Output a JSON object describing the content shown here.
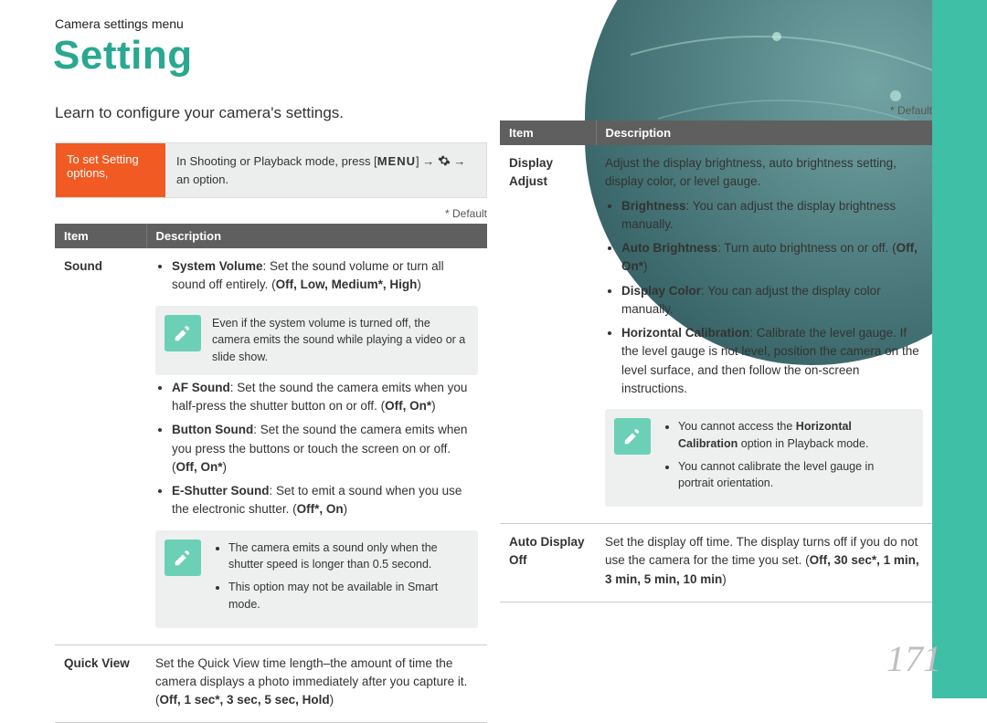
{
  "breadcrumb": "Camera settings menu",
  "title": "Setting",
  "intro": "Learn to configure your camera's settings.",
  "default_note": "* Default",
  "setbox": {
    "label": "To set Setting options,",
    "body_pre": "In Shooting or Playback mode, press [",
    "body_menu": "MENU",
    "body_mid": "] → ",
    "body_post": " → an option."
  },
  "left_table": {
    "headers": {
      "item": "Item",
      "desc": "Description"
    },
    "rows": [
      {
        "item": "Sound",
        "bullets": [
          {
            "label": "System Volume",
            "text": ": Set the sound volume or turn all sound off entirely. (",
            "opts": "Off, Low, Medium*, High",
            "tail": ")"
          }
        ],
        "note1": "Even if the system volume is turned off, the camera emits the sound while playing a video or a slide show.",
        "bullets2": [
          {
            "label": "AF Sound",
            "text": ": Set the sound the camera emits when you half-press the shutter button on or off. (",
            "opts": "Off, On*",
            "tail": ")"
          },
          {
            "label": "Button Sound",
            "text": ": Set the sound the camera emits when you press the buttons or touch the screen on or off. (",
            "opts": "Off, On*",
            "tail": ")"
          },
          {
            "label": "E-Shutter Sound",
            "text": ": Set to emit a sound when you use the electronic shutter. (",
            "opts": "Off*, On",
            "tail": ")"
          }
        ],
        "note2": [
          "The camera emits a sound only when the shutter speed is longer than 0.5 second.",
          "This option may not be available in Smart mode."
        ]
      },
      {
        "item": "Quick View",
        "plain_pre": "Set the Quick View time length–the amount of time the camera displays a photo immediately after you capture it. (",
        "opts": "Off, 1 sec*, 3 sec, 5 sec, Hold",
        "plain_post": ")"
      }
    ]
  },
  "right_table": {
    "headers": {
      "item": "Item",
      "desc": "Description"
    },
    "rows": [
      {
        "item": "Display Adjust",
        "lead": "Adjust the display brightness, auto brightness setting, display color, or level gauge.",
        "bullets": [
          {
            "label": "Brightness",
            "text": ": You can adjust the display brightness manually."
          },
          {
            "label": "Auto Brightness",
            "text": ": Turn auto brightness on or off. (",
            "opts": "Off, On*",
            "tail": ")"
          },
          {
            "label": "Display Color",
            "text": ": You can adjust the display color manually."
          },
          {
            "label": "Horizontal Calibration",
            "text": ": Calibrate the level gauge. If the level gauge is not level, position the camera on the level surface, and then follow the on-screen instructions."
          }
        ],
        "note": [
          {
            "pre": "You cannot access the ",
            "bold": "Horizontal Calibration",
            "post": " option in Playback mode."
          },
          {
            "pre": "You cannot calibrate the level gauge in portrait orientation.",
            "bold": "",
            "post": ""
          }
        ]
      },
      {
        "item": "Auto Display Off",
        "plain_pre": "Set the display off time. The display turns off if you do not use the camera for the time you set. (",
        "opts": "Off, 30 sec*, 1 min, 3 min, 5 min, 10 min",
        "plain_post": ")"
      }
    ]
  },
  "pagenum": "171"
}
